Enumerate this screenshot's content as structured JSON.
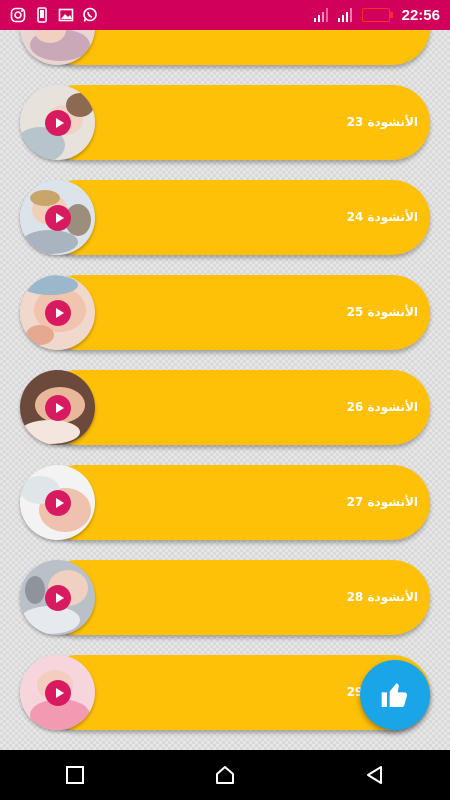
{
  "status_bar": {
    "time": "22:56",
    "left_icons": [
      "instagram-icon",
      "phone-icon",
      "image-icon",
      "whatsapp-icon"
    ],
    "right_icons": [
      "signal-icon",
      "signal-icon",
      "battery-icon"
    ],
    "color": "#d1005a"
  },
  "items": [
    {
      "label": "الأنشودة 23"
    },
    {
      "label": "الأنشودة 24"
    },
    {
      "label": "الأنشودة 25"
    },
    {
      "label": "الأنشودة 26"
    },
    {
      "label": "الأنشودة 27"
    },
    {
      "label": "الأنشودة 28"
    },
    {
      "label": "الأنشودة 29"
    }
  ],
  "colors": {
    "pill": "#ffc107",
    "play": "#d81b60",
    "fab": "#1aa5e8"
  },
  "fab": {
    "icon": "thumbs-up-icon"
  },
  "nav_bar": {
    "buttons": [
      "recent-apps-icon",
      "home-icon",
      "back-icon"
    ]
  }
}
